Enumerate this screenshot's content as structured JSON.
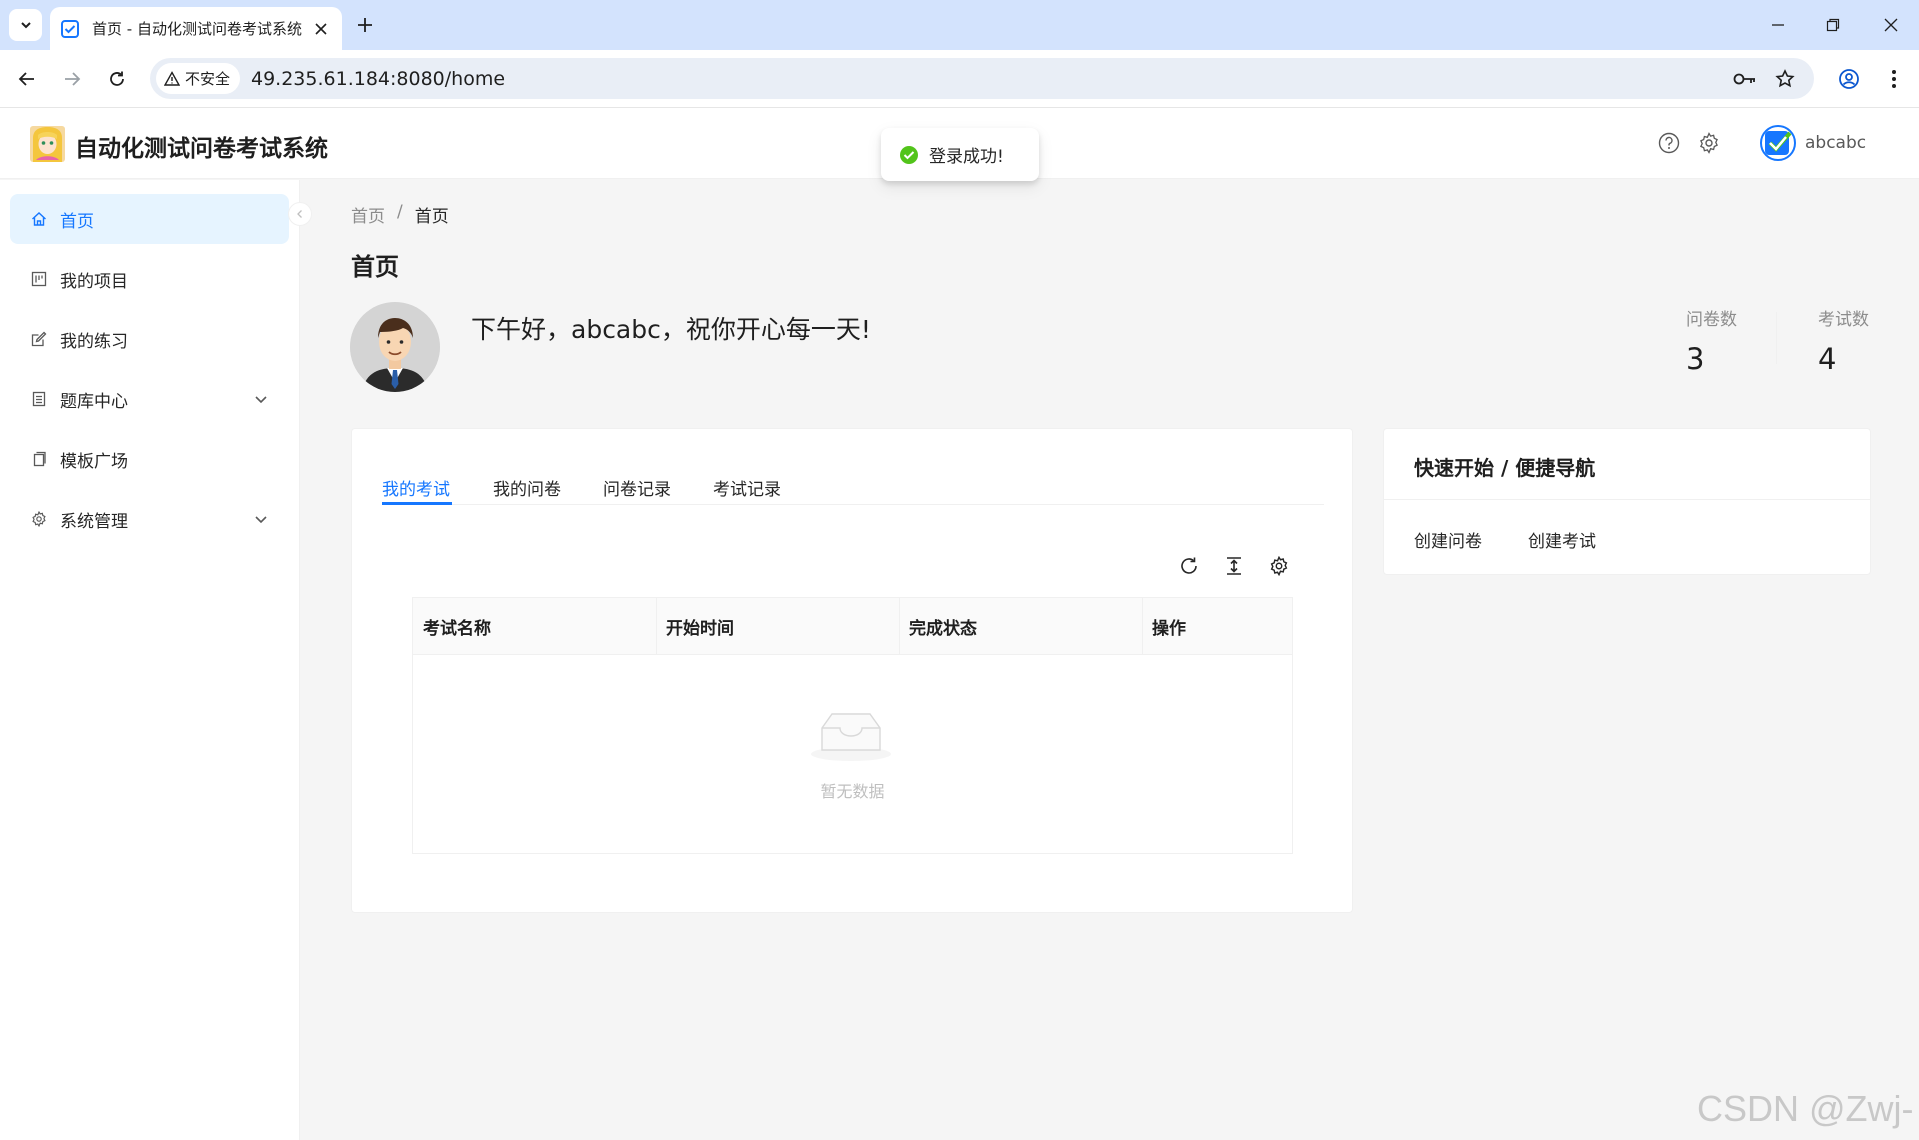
{
  "browser": {
    "tab_title": "首页 - 自动化测试问卷考试系统",
    "security_label": "不安全",
    "url": "49.235.61.184:8080/home"
  },
  "app": {
    "title": "自动化测试问卷考试系统",
    "username": "abcabc"
  },
  "sidebar": {
    "items": [
      {
        "label": "首页",
        "icon": "home-icon"
      },
      {
        "label": "我的项目",
        "icon": "project-icon"
      },
      {
        "label": "我的练习",
        "icon": "edit-icon"
      },
      {
        "label": "题库中心",
        "icon": "book-icon"
      },
      {
        "label": "模板广场",
        "icon": "copy-icon"
      },
      {
        "label": "系统管理",
        "icon": "gear-icon"
      }
    ]
  },
  "breadcrumb": {
    "root": "首页",
    "separator": "/",
    "current": "首页"
  },
  "page": {
    "title": "首页",
    "greeting": "下午好，abcabc，祝你开心每一天!"
  },
  "stats": [
    {
      "label": "问卷数",
      "value": "3"
    },
    {
      "label": "考试数",
      "value": "4"
    }
  ],
  "tabs": [
    "我的考试",
    "我的问卷",
    "问卷记录",
    "考试记录"
  ],
  "table": {
    "columns": [
      "考试名称",
      "开始时间",
      "完成状态",
      "操作"
    ],
    "rows": [],
    "empty_text": "暂无数据"
  },
  "quick_nav": {
    "title": "快速开始 / 便捷导航",
    "links": [
      "创建问卷",
      "创建考试"
    ]
  },
  "toast": {
    "message": "登录成功!"
  },
  "watermark": "CSDN @Zwj-c",
  "colors": {
    "primary": "#1677ff",
    "active_bg": "#e6f4ff",
    "success": "#52c41a",
    "browser_frame": "#d3e3fd"
  }
}
